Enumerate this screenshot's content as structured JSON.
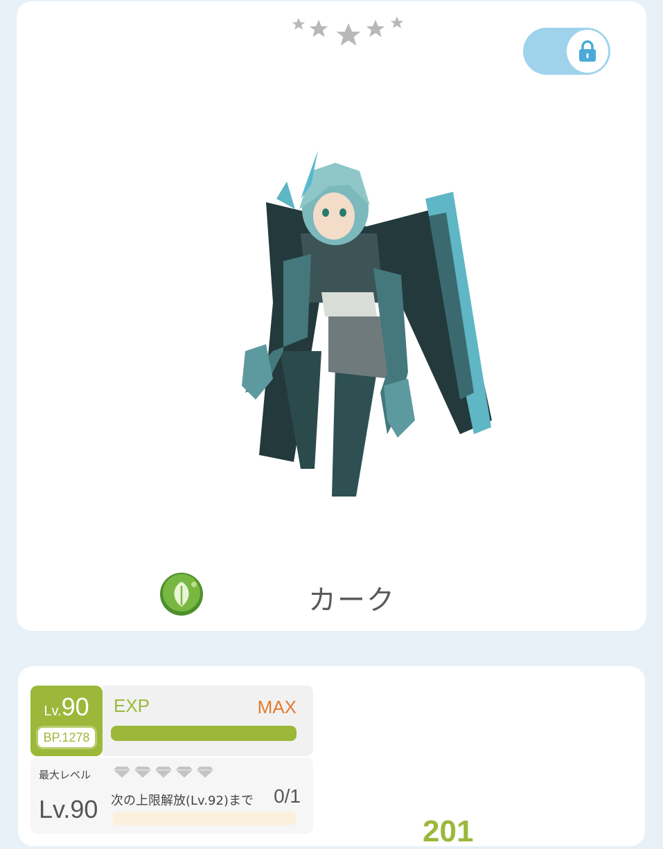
{
  "rarity": {
    "stars_total": 5,
    "stars_filled": 0
  },
  "lock_toggle": {
    "state": "locked",
    "icon": "lock-icon",
    "color": "#9fd3ec"
  },
  "character": {
    "name": "カーク",
    "element_icon": "leaf-icon",
    "element_color": "#6aa83a"
  },
  "level": {
    "prefix": "Lv.",
    "value": "90",
    "bp": "BP.1278",
    "exp_label": "EXP",
    "exp_status": "MAX",
    "exp_progress": 1.0
  },
  "limit_break": {
    "max_level_label": "最大レベル",
    "max_level_value": "Lv.90",
    "gems_total": 5,
    "next_text": "次の上限解放(Lv.92)まで",
    "count": "0/1",
    "progress": 0.0
  },
  "bp_stat_partial": "201",
  "colors": {
    "accent": "#9cb83b",
    "max_orange": "#e47a2e",
    "background": "#e8f1f7"
  }
}
